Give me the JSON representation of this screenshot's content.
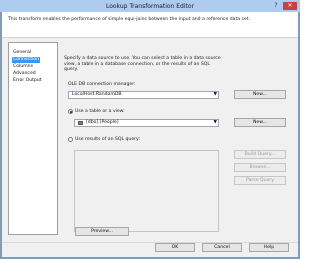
{
  "window": {
    "title": "Lookup Transformation Editor",
    "help_glyph": "?",
    "close_glyph": "✕"
  },
  "banner": {
    "text": "This transform enables the performance of simple equi-joins between the input and a reference data set."
  },
  "nav": {
    "items": [
      {
        "label": "General"
      },
      {
        "label": "Connection"
      },
      {
        "label": "Columns"
      },
      {
        "label": "Advanced"
      },
      {
        "label": "Error Output"
      }
    ],
    "selected": "Connection"
  },
  "content": {
    "description": "Specify a data source to use. You can select a table in a data source view, a table in a database connection, or the results of an SQL query.",
    "connection_manager_label": "OLE DB connection manager:",
    "connection_manager_value": "LocalHost.RandomDB",
    "new_connection_button": "New...",
    "use_table_label": "Use a table or a view:",
    "use_table_selected": true,
    "table_value": "[dbo].[People]",
    "new_table_button": "New...",
    "use_sql_label": "Use results of an SQL query:",
    "use_sql_selected": false,
    "build_query_button": "Build Query...",
    "browse_button": "Browse...",
    "parse_query_button": "Parse Query",
    "preview_button": "Preview..."
  },
  "footer": {
    "ok_button": "OK",
    "cancel_button": "Cancel",
    "help_button": "Help"
  },
  "colors": {
    "selection": "#3399ff",
    "title_bar": "#aeccf0",
    "close_button": "#c6423a"
  }
}
